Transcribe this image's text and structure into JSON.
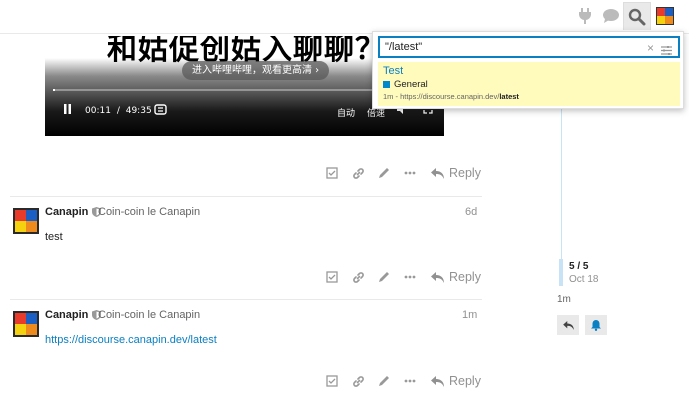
{
  "video": {
    "subtitle": "和姑促创姑入聊聊？",
    "hd_prompt": "进入哔哩哔哩，观看更高清 ›",
    "time_current": "00:11",
    "time_sep": "/",
    "time_total": "49:35",
    "auto_label": "自动",
    "speed_label": "倍速",
    "progress_fraction": 0.004
  },
  "actions": {
    "reply_label": "Reply"
  },
  "posts": [
    {
      "username": "Canapin",
      "full_name": "Coin-coin le Canapin",
      "date": "6d",
      "body": "test"
    },
    {
      "username": "Canapin",
      "full_name": "Coin-coin le Canapin",
      "date": "1m",
      "link_text": "https://discourse.canapin.dev/latest"
    }
  ],
  "timeline": {
    "count": "5 / 5",
    "date": "Oct 18",
    "bottom_date": "1m"
  },
  "search": {
    "query": "\"/latest\"",
    "clear_glyph": "×",
    "result": {
      "title": "Test",
      "category": "General",
      "category_color": "#0088cc",
      "blurb_prefix": "1m - https://discourse.canapin.dev/",
      "blurb_highlight": "latest"
    }
  },
  "colors": {
    "accent": "#0a7fc2",
    "highlight": "#fffbbd",
    "muted": "#919191"
  }
}
